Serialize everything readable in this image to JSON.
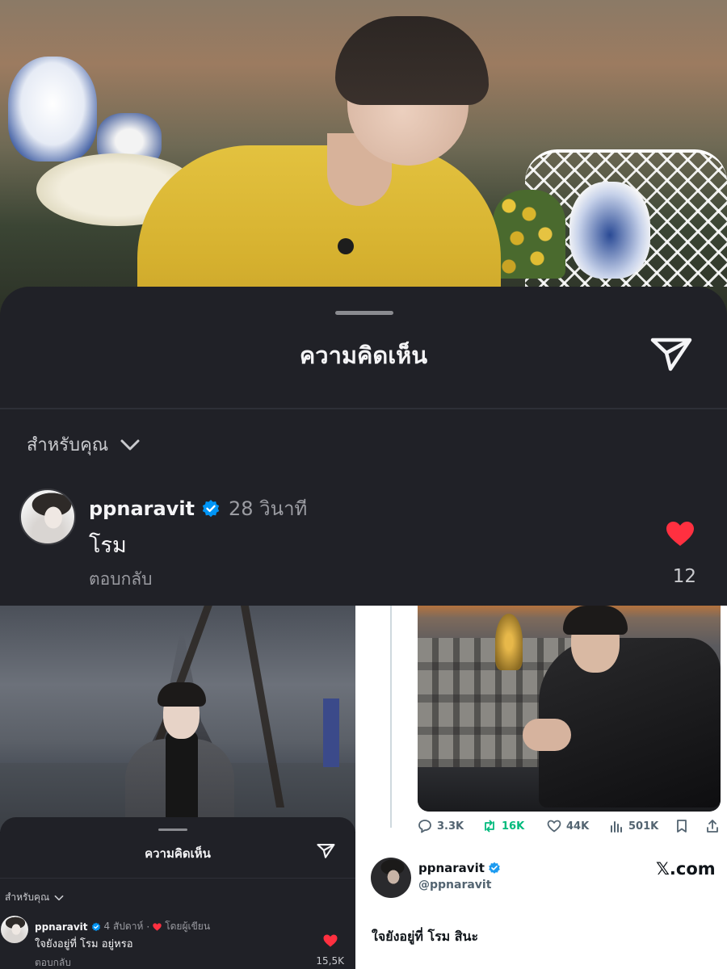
{
  "main_sheet": {
    "title": "ความคิดเห็น",
    "filter_label": "สำหรับคุณ",
    "comment": {
      "username": "ppnaravit",
      "time": "28 วินาที",
      "text": "โรม",
      "reply_label": "ตอบกลับ",
      "like_count": "12"
    }
  },
  "mini_sheet": {
    "title": "ความคิดเห็น",
    "filter_label": "สำหรับคุณ",
    "comment": {
      "username": "ppnaravit",
      "time": "4 สัปดาห์",
      "separator": "·",
      "author_liked": "โดยผู้เขียน",
      "text": "ใจยังอยู่ที่ โรม  อยู่หรอ",
      "reply_label": "ตอบกลับ",
      "like_count": "15,5K"
    }
  },
  "x_post": {
    "stats": {
      "replies": "3.3K",
      "reposts": "16K",
      "likes": "44K",
      "views": "501K"
    },
    "display_name": "ppnaravit",
    "handle": "@ppnaravit",
    "brand": "𝕏.com",
    "text": "ใจยังอยู่ที่ โรม สินะ"
  },
  "icons": {
    "send": "paper-plane-icon",
    "chevron": "chevron-down-icon",
    "verified": "verified-badge-icon",
    "heart": "heart-icon",
    "reply": "speech-bubble-icon",
    "repost": "repost-icon",
    "like": "heart-outline-icon",
    "views": "bar-chart-icon",
    "bookmark": "bookmark-icon",
    "share": "share-icon"
  },
  "colors": {
    "sheet_bg": "#202127",
    "heart_red": "#ff3040",
    "verified_blue": "#0095f6",
    "x_verified_blue": "#1d9bf0",
    "x_repost_green": "#00ba7c"
  }
}
